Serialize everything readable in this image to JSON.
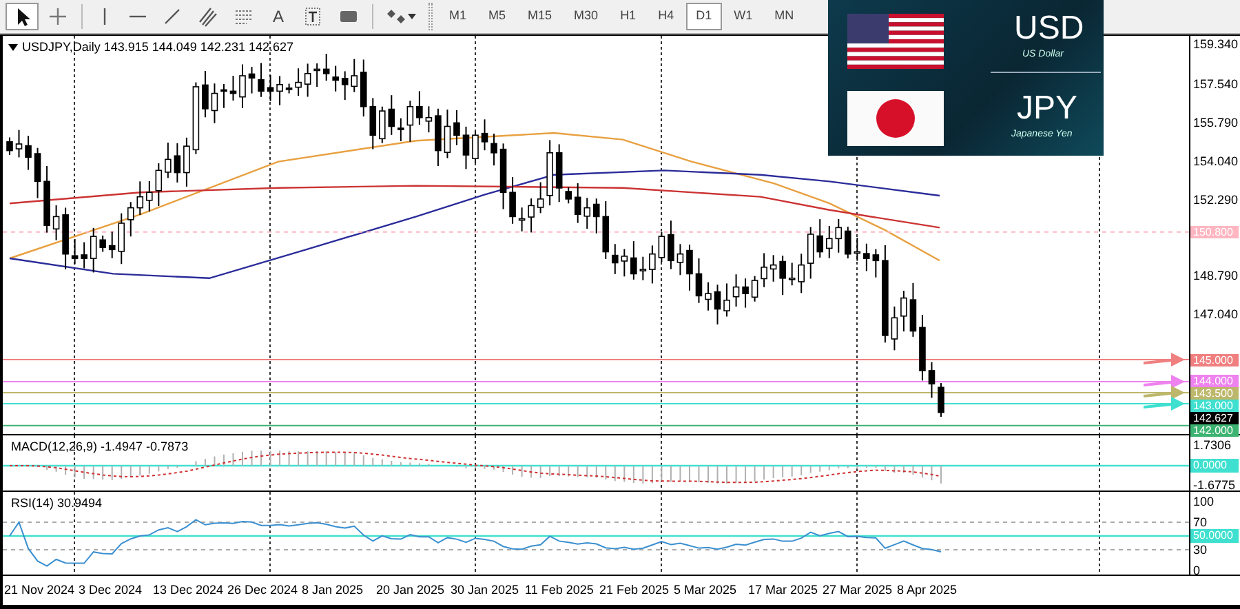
{
  "toolbar": {
    "tools": [
      {
        "kind": "pointer",
        "selected": true
      },
      {
        "kind": "crosshair",
        "selected": false
      },
      {
        "kind": "vline",
        "selected": false
      },
      {
        "kind": "hline",
        "selected": false
      },
      {
        "kind": "trendline",
        "selected": false
      },
      {
        "kind": "fibchannel",
        "selected": false
      },
      {
        "kind": "fiblevels",
        "selected": false
      },
      {
        "kind": "text",
        "label": "A",
        "selected": false
      },
      {
        "kind": "textlabel",
        "selected": false
      },
      {
        "kind": "rectangle",
        "selected": false
      },
      {
        "kind": "shapes",
        "selected": false
      }
    ],
    "timeframes": [
      {
        "label": "M1",
        "selected": false
      },
      {
        "label": "M5",
        "selected": false
      },
      {
        "label": "M15",
        "selected": false
      },
      {
        "label": "M30",
        "selected": false
      },
      {
        "label": "H1",
        "selected": false
      },
      {
        "label": "H4",
        "selected": false
      },
      {
        "label": "D1",
        "selected": true
      },
      {
        "label": "W1",
        "selected": false
      },
      {
        "label": "MN",
        "selected": false
      }
    ]
  },
  "banner": {
    "base_code": "USD",
    "base_name": "US Dollar",
    "quote_code": "JPY",
    "quote_name": "Japanese Yen"
  },
  "chart": {
    "header": "USDJPY,Daily  143.915 144.049 142.231 142.627",
    "price_ticks": [
      "159.340",
      "157.540",
      "155.790",
      "154.040",
      "152.290",
      "148.790",
      "147.040"
    ],
    "levels": [
      {
        "label": "150.800",
        "color": "#ffb6c1",
        "kind": "dashed",
        "arrow": false
      },
      {
        "label": "145.000",
        "color": "#f08080",
        "kind": "solid",
        "arrow": true
      },
      {
        "label": "144.000",
        "color": "#ee82ee",
        "kind": "solid",
        "arrow": true
      },
      {
        "label": "143.500",
        "color": "#bdb76b",
        "kind": "solid",
        "arrow": true
      },
      {
        "label": "143.000",
        "color": "#40e0d0",
        "kind": "solid",
        "arrow": true
      },
      {
        "label": "142.627",
        "color": "#000000",
        "kind": "price",
        "arrow": false
      },
      {
        "label": "142.000",
        "color": "#3cb371",
        "kind": "solid",
        "arrow": false
      }
    ],
    "macd": {
      "label": "MACD(12,26,9) -1.4947 -0.7873",
      "ticks": [
        "1.7306",
        "-1.6775"
      ],
      "zero_label": "0.0000"
    },
    "rsi": {
      "label": "RSI(14) 30.9494",
      "ticks": [
        "100",
        "70",
        "30",
        "0"
      ],
      "mid_label": "50.0000"
    },
    "dates": [
      "21 Nov 2024",
      "3 Dec 2024",
      "13 Dec 2024",
      "26 Dec 2024",
      "8 Jan 2025",
      "20 Jan 2025",
      "30 Jan 2025",
      "11 Feb 2025",
      "21 Feb 2025",
      "5 Mar 2025",
      "17 Mar 2025",
      "27 Mar 2025",
      "8 Apr 2025"
    ]
  }
}
